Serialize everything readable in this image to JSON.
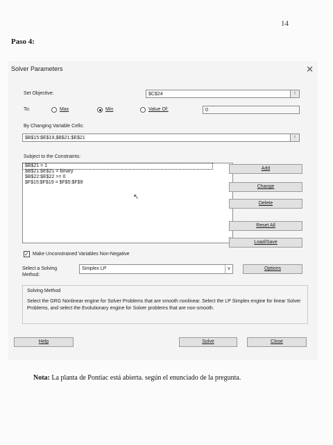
{
  "page": {
    "number": "14",
    "step_heading": "Paso 4:"
  },
  "dialog": {
    "title": "Solver Parameters",
    "close_glyph": "✕",
    "set_objective_label": "Set Objective:",
    "objective_value": "$C$24",
    "to_label": "To:",
    "radio_max": "Max",
    "radio_min": "Min",
    "radio_value_of": "Value Of:",
    "selected_goal": "Min",
    "value_of_input": "0",
    "changing_cells_label": "By Changing Variable Cells:",
    "changing_cells_value": "$B$15:$E$19,$B$21:$E$21",
    "constraints_label": "Subject to the Constraints:",
    "constraints": [
      "$B$21 = 1",
      "$B$21:$E$21 = binary",
      "$B$22:$E$22 >= 0",
      "$F$15:$F$19 = $F$5:$F$9"
    ],
    "buttons": {
      "add": "Add",
      "change": "Change",
      "delete": "Delete",
      "reset_all": "Reset All",
      "load_save": "Load/Save",
      "options": "Options",
      "help": "Help",
      "solve": "Solve",
      "close": "Close"
    },
    "nonneg_checkbox_label": "Make Unconstrained Variables Non-Negative",
    "nonneg_checked": true,
    "solving_method_label": "Select a Solving Method:",
    "solving_method_value": "Simplex LP",
    "solving_method_group_title": "Solving Method",
    "solving_method_description": "Select the GRG Nonlinear engine for Solver Problems that are smooth nonlinear. Select the LP Simplex engine for linear Solver Problems, and select the Evolutionary engine for Solver problems that are non-smooth."
  },
  "note": {
    "prefix": "Nota:",
    "text": "La planta de Pontiac está abierta. según el enunciado de la pregunta."
  },
  "icons": {
    "collapse_icon": "↑",
    "scroll_up_icon": "^",
    "scroll_down_icon": "v",
    "dropdown_icon": "v",
    "cursor_icon": "↖"
  }
}
